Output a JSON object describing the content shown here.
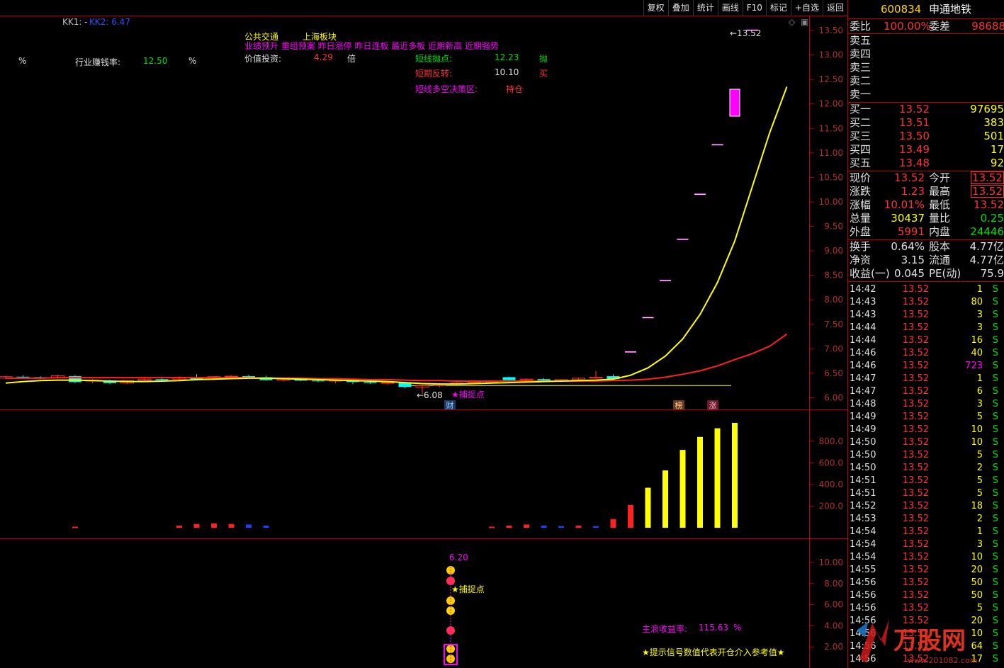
{
  "toolbar": [
    "复权",
    "叠加",
    "统计",
    "画线",
    "F10",
    "标记",
    "+自选",
    "返回"
  ],
  "header": {
    "kk1_label": "KK1: -",
    "kk2_label": "KK2: 6.47",
    "sector": "公共交通",
    "board": "上海板块",
    "tags": "业绩预升 重组预案 昨日涨停 昨日连板 最近多板 近期新高 近期强势",
    "value_label": "价值投资:",
    "value_num": "4.29",
    "value_unit": "倍",
    "percent_left": "%",
    "industry_label": "行业赚钱率:",
    "industry_val": "12.50",
    "industry_unit": "%",
    "sell_point_label": "短线抛点:",
    "sell_point_val": "12.23",
    "sell_point_flag": "抛",
    "reversal_label": "短期反转:",
    "reversal_val": "10.10",
    "reversal_flag": "买",
    "decision_label": "短线多空决策区:",
    "decision_val": "持仓"
  },
  "annotations": {
    "high_marker": "13.52",
    "low_marker": "6.08",
    "capture_main": "★捕捉点",
    "capture_sub": "★捕捉点",
    "badge_cai": "财",
    "badge_bang": "榜",
    "badge_zhang": "涨",
    "sub_value": "6.20",
    "profit_label": "主浪收益率:",
    "profit_val": "115.63",
    "profit_unit": "%",
    "hint": "★提示信号数值代表开仓介入参考值★"
  },
  "colors": {
    "up": "#ff3232",
    "down": "#00ffff",
    "ma_yellow": "#ffff00",
    "ma_red": "#ff2020",
    "magenta": "#ff00ff",
    "gold": "#ffd700",
    "green": "#00e000"
  },
  "chart_data": [
    {
      "type": "candlestick",
      "title": "",
      "ylim": [
        5.9,
        13.7
      ],
      "yticks": [
        "13.50",
        "13.00",
        "12.50",
        "12.00",
        "11.50",
        "11.00",
        "10.50",
        "10.00",
        "9.50",
        "9.00",
        "8.50",
        "8.00",
        "7.50",
        "7.00",
        "6.50",
        "6.00"
      ],
      "ytick_values": [
        13.5,
        13.0,
        12.5,
        12.0,
        11.5,
        11.0,
        10.5,
        10.0,
        9.5,
        9.0,
        8.5,
        8.0,
        7.5,
        7.0,
        6.5,
        6.0
      ],
      "candles": [
        [
          6.4,
          6.45,
          6.38,
          6.43
        ],
        [
          6.43,
          6.46,
          6.4,
          6.42
        ],
        [
          6.42,
          6.44,
          6.38,
          6.41
        ],
        [
          6.41,
          6.47,
          6.39,
          6.45
        ],
        [
          6.44,
          6.46,
          6.3,
          6.32
        ],
        [
          6.34,
          6.38,
          6.3,
          6.36
        ],
        [
          6.35,
          6.37,
          6.28,
          6.3
        ],
        [
          6.3,
          6.36,
          6.28,
          6.35
        ],
        [
          6.35,
          6.4,
          6.33,
          6.38
        ],
        [
          6.38,
          6.42,
          6.35,
          6.36
        ],
        [
          6.38,
          6.44,
          6.36,
          6.42
        ],
        [
          6.42,
          6.48,
          6.4,
          6.38
        ],
        [
          6.38,
          6.44,
          6.36,
          6.43
        ],
        [
          6.43,
          6.46,
          6.4,
          6.44
        ],
        [
          6.44,
          6.47,
          6.41,
          6.42
        ],
        [
          6.42,
          6.45,
          6.35,
          6.36
        ],
        [
          6.36,
          6.4,
          6.33,
          6.38
        ],
        [
          6.38,
          6.4,
          6.34,
          6.35
        ],
        [
          6.35,
          6.38,
          6.32,
          6.34
        ],
        [
          6.34,
          6.37,
          6.3,
          6.36
        ],
        [
          6.34,
          6.36,
          6.28,
          6.32
        ],
        [
          6.32,
          6.35,
          6.28,
          6.3
        ],
        [
          6.3,
          6.34,
          6.26,
          6.31
        ],
        [
          6.31,
          6.33,
          6.2,
          6.22
        ],
        [
          6.22,
          6.26,
          6.08,
          6.25
        ],
        [
          6.25,
          6.3,
          6.22,
          6.28
        ],
        [
          6.28,
          6.33,
          6.26,
          6.3
        ],
        [
          6.3,
          6.34,
          6.28,
          6.32
        ],
        [
          6.32,
          6.36,
          6.3,
          6.34
        ],
        [
          6.42,
          6.43,
          6.35,
          6.36
        ],
        [
          6.36,
          6.4,
          6.33,
          6.38
        ],
        [
          6.38,
          6.4,
          6.34,
          6.35
        ],
        [
          6.35,
          6.38,
          6.32,
          6.37
        ],
        [
          6.37,
          6.41,
          6.35,
          6.4
        ],
        [
          6.4,
          6.55,
          6.39,
          6.42
        ],
        [
          6.44,
          6.48,
          6.36,
          6.38
        ],
        [
          6.93,
          6.95,
          6.93,
          6.95
        ],
        [
          7.64,
          7.65,
          7.64,
          7.65
        ],
        [
          8.4,
          8.41,
          8.4,
          8.41
        ],
        [
          9.24,
          9.25,
          9.24,
          9.25
        ],
        [
          10.16,
          10.17,
          10.16,
          10.17
        ],
        [
          11.17,
          11.18,
          11.17,
          11.18
        ],
        [
          11.75,
          12.3,
          11.75,
          12.3
        ],
        [
          13.52,
          13.52,
          13.52,
          13.52
        ]
      ],
      "ma_yellow": [
        6.3,
        6.33,
        6.35,
        6.36,
        6.36,
        6.35,
        6.34,
        6.33,
        6.33,
        6.34,
        6.35,
        6.37,
        6.38,
        6.39,
        6.4,
        6.4,
        6.39,
        6.38,
        6.37,
        6.36,
        6.35,
        6.34,
        6.33,
        6.31,
        6.29,
        6.28,
        6.28,
        6.29,
        6.3,
        6.31,
        6.32,
        6.33,
        6.34,
        6.35,
        6.36,
        6.38,
        6.46,
        6.61,
        6.85,
        7.2,
        7.7,
        8.35,
        9.2,
        10.3,
        11.4,
        12.35
      ],
      "ma_red": [
        6.4,
        6.4,
        6.4,
        6.41,
        6.41,
        6.41,
        6.41,
        6.41,
        6.41,
        6.41,
        6.41,
        6.41,
        6.41,
        6.41,
        6.41,
        6.4,
        6.4,
        6.4,
        6.39,
        6.39,
        6.38,
        6.37,
        6.37,
        6.36,
        6.35,
        6.35,
        6.34,
        6.34,
        6.34,
        6.34,
        6.34,
        6.34,
        6.34,
        6.34,
        6.34,
        6.35,
        6.36,
        6.38,
        6.42,
        6.48,
        6.55,
        6.65,
        6.78,
        6.9,
        7.05,
        7.3
      ],
      "flat_line": 6.25
    },
    {
      "type": "bar",
      "title": "",
      "ylim": [
        0,
        1000
      ],
      "yticks": [
        "800.0",
        "600.0",
        "400.0",
        "200.0"
      ],
      "ytick_values": [
        800,
        600,
        400,
        200
      ],
      "bars": [
        {
          "i": 4,
          "v": 10,
          "c": "r"
        },
        {
          "i": 10,
          "v": 20,
          "c": "r"
        },
        {
          "i": 11,
          "v": 35,
          "c": "r"
        },
        {
          "i": 12,
          "v": 40,
          "c": "r"
        },
        {
          "i": 13,
          "v": 35,
          "c": "r"
        },
        {
          "i": 14,
          "v": 30,
          "c": "b"
        },
        {
          "i": 15,
          "v": 20,
          "c": "b"
        },
        {
          "i": 28,
          "v": 10,
          "c": "r"
        },
        {
          "i": 29,
          "v": 20,
          "c": "r"
        },
        {
          "i": 30,
          "v": 30,
          "c": "r"
        },
        {
          "i": 31,
          "v": 20,
          "c": "b"
        },
        {
          "i": 32,
          "v": 15,
          "c": "b"
        },
        {
          "i": 33,
          "v": 20,
          "c": "r"
        },
        {
          "i": 34,
          "v": 15,
          "c": "b"
        },
        {
          "i": 35,
          "v": 80,
          "c": "r"
        },
        {
          "i": 36,
          "v": 210,
          "c": "r"
        },
        {
          "i": 37,
          "v": 370,
          "c": "y"
        },
        {
          "i": 38,
          "v": 530,
          "c": "y"
        },
        {
          "i": 39,
          "v": 720,
          "c": "y"
        },
        {
          "i": 40,
          "v": 840,
          "c": "y"
        },
        {
          "i": 41,
          "v": 920,
          "c": "y"
        },
        {
          "i": 42,
          "v": 970,
          "c": "y"
        }
      ]
    },
    {
      "type": "signal",
      "title": "",
      "ylim": [
        0.8,
        12.0
      ],
      "yticks": [
        "10.00",
        "8.00",
        "6.00",
        "4.00",
        "2.00"
      ],
      "ytick_values": [
        10,
        8,
        6,
        4,
        2
      ]
    }
  ],
  "quote": {
    "code": "600834",
    "name": "申通地铁",
    "weibi_label": "委比",
    "weibi_val": "100.00%",
    "weicha_label": "委差",
    "weicha_val": "98688",
    "sell": [
      {
        "label": "卖五",
        "price": "",
        "vol": ""
      },
      {
        "label": "卖四",
        "price": "",
        "vol": ""
      },
      {
        "label": "卖三",
        "price": "",
        "vol": ""
      },
      {
        "label": "卖二",
        "price": "",
        "vol": ""
      },
      {
        "label": "卖一",
        "price": "",
        "vol": ""
      }
    ],
    "buy": [
      {
        "label": "买一",
        "price": "13.52",
        "vol": "97695"
      },
      {
        "label": "买二",
        "price": "13.51",
        "vol": "383"
      },
      {
        "label": "买三",
        "price": "13.50",
        "vol": "501"
      },
      {
        "label": "买四",
        "price": "13.49",
        "vol": "17"
      },
      {
        "label": "买五",
        "price": "13.48",
        "vol": "92"
      }
    ],
    "stats": [
      {
        "l1": "现价",
        "v1": "13.52",
        "c1": "#ff3232",
        "l2": "今开",
        "v2": "13.52",
        "c2": "#ff3232",
        "box": true
      },
      {
        "l1": "涨跌",
        "v1": "1.23",
        "c1": "#ff3232",
        "l2": "最高",
        "v2": "13.52",
        "c2": "#ff3232",
        "box": true
      },
      {
        "l1": "涨幅",
        "v1": "10.01%",
        "c1": "#ff3232",
        "l2": "最低",
        "v2": "13.52",
        "c2": "#ff3232",
        "box": false
      },
      {
        "l1": "总量",
        "v1": "30437",
        "c1": "#ffff00",
        "l2": "量比",
        "v2": "0.25",
        "c2": "#00e000",
        "box": false
      },
      {
        "l1": "外盘",
        "v1": "5991",
        "c1": "#ff3232",
        "l2": "内盘",
        "v2": "24446",
        "c2": "#00e000",
        "box": false
      }
    ],
    "fund": [
      {
        "l1": "换手",
        "v1": "0.64%",
        "l2": "股本",
        "v2": "4.77亿"
      },
      {
        "l1": "净资",
        "v1": "3.15",
        "l2": "流通",
        "v2": "4.77亿"
      },
      {
        "l1": "收益(一)",
        "v1": "0.045",
        "l2": "PE(动)",
        "v2": "75.9"
      }
    ]
  },
  "ticks": [
    {
      "t": "14:42",
      "p": "13.52",
      "v": "1",
      "s": "S"
    },
    {
      "t": "14:43",
      "p": "13.52",
      "v": "80",
      "s": "S"
    },
    {
      "t": "14:43",
      "p": "13.52",
      "v": "3",
      "s": "S"
    },
    {
      "t": "14:44",
      "p": "13.52",
      "v": "3",
      "s": "S"
    },
    {
      "t": "14:44",
      "p": "13.52",
      "v": "16",
      "s": "S"
    },
    {
      "t": "14:46",
      "p": "13.52",
      "v": "40",
      "s": "S"
    },
    {
      "t": "14:46",
      "p": "13.52",
      "v": "723",
      "s": "S"
    },
    {
      "t": "14:47",
      "p": "13.52",
      "v": "1",
      "s": "S"
    },
    {
      "t": "14:47",
      "p": "13.52",
      "v": "6",
      "s": "S"
    },
    {
      "t": "14:48",
      "p": "13.52",
      "v": "3",
      "s": "S"
    },
    {
      "t": "14:49",
      "p": "13.52",
      "v": "5",
      "s": "S"
    },
    {
      "t": "14:49",
      "p": "13.52",
      "v": "10",
      "s": "S"
    },
    {
      "t": "14:50",
      "p": "13.52",
      "v": "10",
      "s": "S"
    },
    {
      "t": "14:50",
      "p": "13.52",
      "v": "5",
      "s": "S"
    },
    {
      "t": "14:50",
      "p": "13.52",
      "v": "2",
      "s": "S"
    },
    {
      "t": "14:51",
      "p": "13.52",
      "v": "5",
      "s": "S"
    },
    {
      "t": "14:51",
      "p": "13.52",
      "v": "5",
      "s": "S"
    },
    {
      "t": "14:52",
      "p": "13.52",
      "v": "18",
      "s": "S"
    },
    {
      "t": "14:53",
      "p": "13.52",
      "v": "2",
      "s": "S"
    },
    {
      "t": "14:54",
      "p": "13.52",
      "v": "1",
      "s": "S"
    },
    {
      "t": "14:54",
      "p": "13.52",
      "v": "3",
      "s": "S"
    },
    {
      "t": "14:54",
      "p": "13.52",
      "v": "10",
      "s": "S"
    },
    {
      "t": "14:55",
      "p": "13.52",
      "v": "20",
      "s": "S"
    },
    {
      "t": "14:56",
      "p": "13.52",
      "v": "50",
      "s": "S"
    },
    {
      "t": "14:56",
      "p": "13.52",
      "v": "50",
      "s": "S"
    },
    {
      "t": "14:56",
      "p": "13.52",
      "v": "5",
      "s": "S"
    },
    {
      "t": "14:56",
      "p": "13.52",
      "v": "20",
      "s": "S"
    },
    {
      "t": "14:56",
      "p": "13.52",
      "v": "10",
      "s": "S"
    },
    {
      "t": "14:56",
      "p": "13.52",
      "v": "64",
      "s": "S"
    },
    {
      "t": "14:56",
      "p": "13.52",
      "v": "17",
      "s": "S"
    }
  ],
  "watermark": {
    "brand": "万股网",
    "url": "www.201082.com"
  }
}
